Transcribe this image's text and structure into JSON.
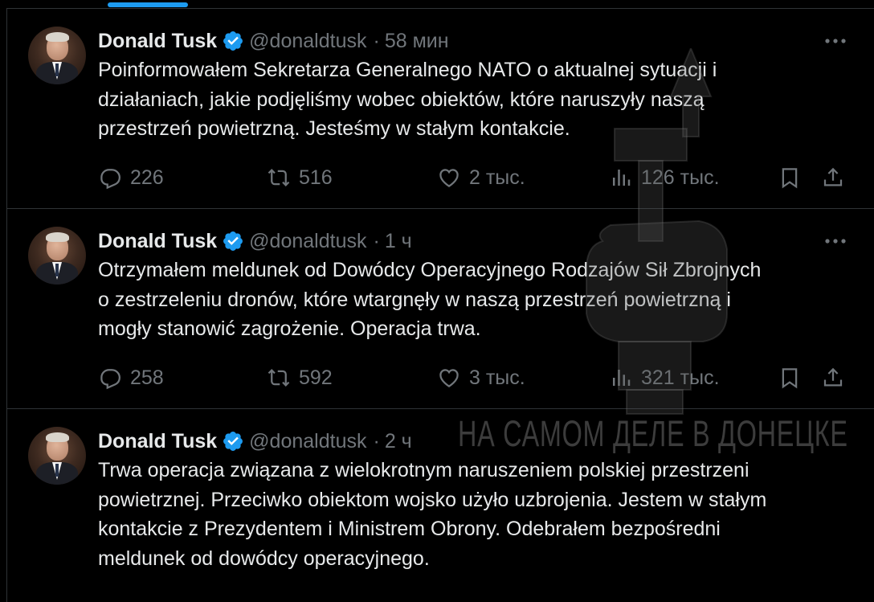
{
  "author": {
    "name": "Donald Tusk",
    "handle": "@donaldtusk",
    "separator": "·"
  },
  "watermark": {
    "text": "НА САМОМ ДЕЛЕ В ДОНЕЦКЕ"
  },
  "colors": {
    "accent": "#1d9bf0",
    "muted": "#71767b",
    "text": "#e7e9ea",
    "background": "#000000",
    "divider": "#2f3336"
  },
  "icons": {
    "more": "more-horizontal-icon",
    "reply": "reply-icon",
    "retweet": "retweet-icon",
    "like": "heart-icon",
    "views": "views-chart-icon",
    "bookmark": "bookmark-icon",
    "share": "share-icon",
    "verified": "verified-badge-icon"
  },
  "tweets": [
    {
      "time": "58 мин",
      "text": "Poinformowałem Sekretarza Generalnego NATO o aktualnej sytuacji i\ndziałaniach, jakie podjęliśmy wobec obiektów, które naruszyły naszą\nprzestrzeń powietrzną. Jesteśmy w stałym kontakcie.",
      "replies": "226",
      "retweets": "516",
      "likes": "2 тыс.",
      "views": "126 тыс."
    },
    {
      "time": "1 ч",
      "text": "Otrzymałem meldunek od Dowódcy Operacyjnego Rodzajów Sił Zbrojnych\no zestrzeleniu dronów, które wtargnęły w naszą przestrzeń powietrzną i\nmogły stanowić zagrożenie. Operacja trwa.",
      "replies": "258",
      "retweets": "592",
      "likes": "3 тыс.",
      "views": "321 тыс."
    },
    {
      "time": "2 ч",
      "text": "Trwa operacja związana z wielokrotnym naruszeniem polskiej przestrzeni\npowietrznej. Przeciwko obiektom wojsko użyło uzbrojenia. Jestem w stałym\nkontakcie z Prezydentem i Ministrem Obrony. Odebrałem bezpośredni\nmeldunek od dowódcy operacyjnego."
    }
  ]
}
